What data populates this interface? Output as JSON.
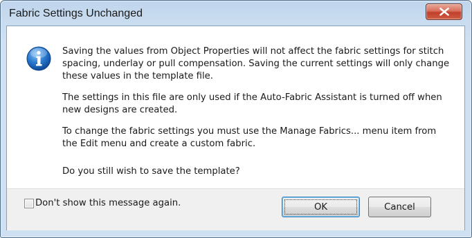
{
  "dialog": {
    "title": "Fabric Settings Unchanged",
    "icon": "info-icon",
    "messages": [
      "Saving the values from Object Properties will not affect the fabric settings for stitch spacing, underlay or pull compensation. Saving the current settings will only change these values in the template file.",
      "The settings in this file are only used if the Auto-Fabric Assistant is turned off when new designs are created.",
      "To change the fabric settings you must use the Manage Fabrics... menu item from the Edit menu and create a custom fabric.",
      "Do you still wish to save the template?"
    ],
    "checkbox_label": "Don't show this message again.",
    "checkbox_checked": false,
    "ok_label": "OK",
    "cancel_label": "Cancel",
    "colors": {
      "close_button": "#c9452f",
      "info_icon": "#1f6fc9"
    }
  }
}
